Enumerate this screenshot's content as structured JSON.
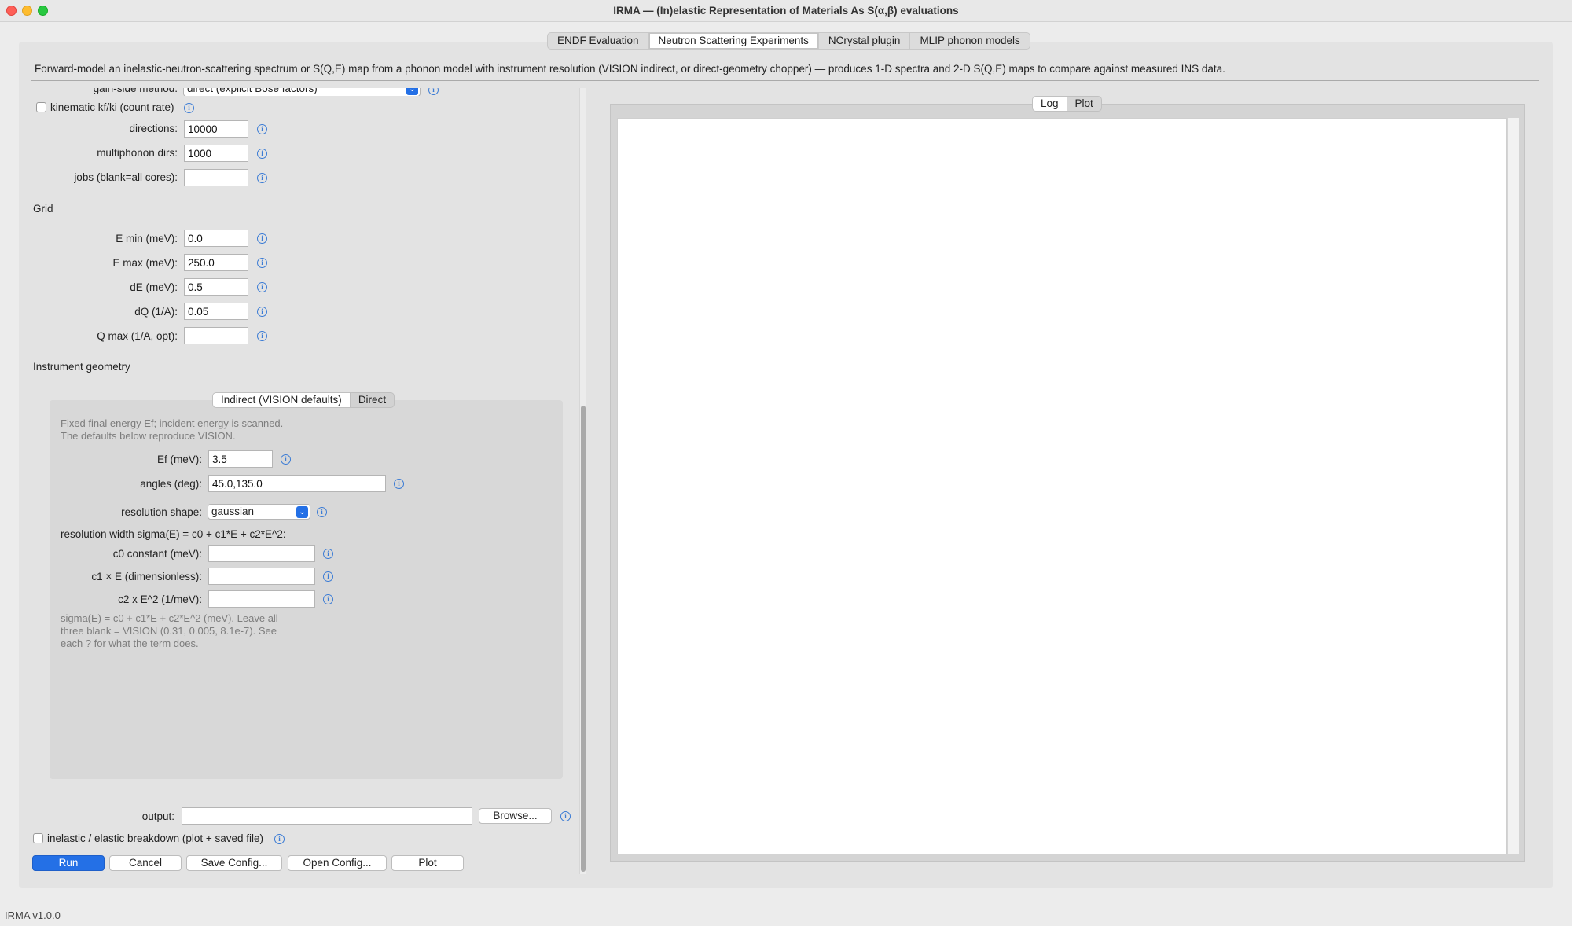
{
  "window": {
    "title": "IRMA — (In)elastic Representation of Materials As S(α,β) evaluations"
  },
  "tabs": [
    "ENDF Evaluation",
    "Neutron Scattering Experiments",
    "NCrystal plugin",
    "MLIP phonon models"
  ],
  "description": "Forward-model an inelastic-neutron-scattering spectrum or S(Q,E) map from a phonon model with instrument resolution (VISION indirect, or direct-geometry chopper) — produces 1-D spectra and 2-D S(Q,E) maps to compare against measured INS data.",
  "params": {
    "gain_side_label": "gain-side method:",
    "gain_side_value": "direct (explicit Bose factors)",
    "kinematic_label": "kinematic kf/ki (count rate)",
    "directions_label": "directions:",
    "directions_value": "10000",
    "multiphonon_label": "multiphonon dirs:",
    "multiphonon_value": "1000",
    "jobs_label": "jobs (blank=all cores):",
    "jobs_value": ""
  },
  "grid": {
    "title": "Grid",
    "emin_label": "E min (meV):",
    "emin_value": "0.0",
    "emax_label": "E max (meV):",
    "emax_value": "250.0",
    "de_label": "dE (meV):",
    "de_value": "0.5",
    "dq_label": "dQ (1/A):",
    "dq_value": "0.05",
    "qmax_label": "Q max (1/A, opt):",
    "qmax_value": ""
  },
  "instrument": {
    "title": "Instrument geometry",
    "tabs": [
      "Indirect (VISION defaults)",
      "Direct"
    ],
    "note1": "Fixed final energy Ef; incident energy is scanned.",
    "note2": "The defaults below reproduce VISION.",
    "ef_label": "Ef (meV):",
    "ef_value": "3.5",
    "angles_label": "angles (deg):",
    "angles_value": "45.0,135.0",
    "shape_label": "resolution shape:",
    "shape_value": "gaussian",
    "width_label": "resolution width  sigma(E) = c0 + c1*E + c2*E^2:",
    "c0_label": "c0  constant (meV):",
    "c0_value": "",
    "c1_label": "c1 × E (dimensionless):",
    "c1_value": "",
    "c2_label": "c2  x E^2 (1/meV):",
    "c2_value": "",
    "help1": "sigma(E) = c0 + c1*E + c2*E^2 (meV).  Leave all",
    "help2": "three blank = VISION (0.31, 0.005, 8.1e-7).  See",
    "help3": "each ? for what the term does."
  },
  "output": {
    "label": "output:",
    "value": "",
    "browse": "Browse...",
    "breakdown_label": "inelastic / elastic breakdown (plot + saved file)"
  },
  "buttons": {
    "run": "Run",
    "cancel": "Cancel",
    "save": "Save Config...",
    "open": "Open Config...",
    "plot": "Plot"
  },
  "right_tabs": [
    "Log",
    "Plot"
  ],
  "info_glyph": "i",
  "select_glyph": "⌄",
  "status": "IRMA v1.0.0",
  "colors": {
    "accent": "#2470e6",
    "info": "#3a7bd5"
  }
}
